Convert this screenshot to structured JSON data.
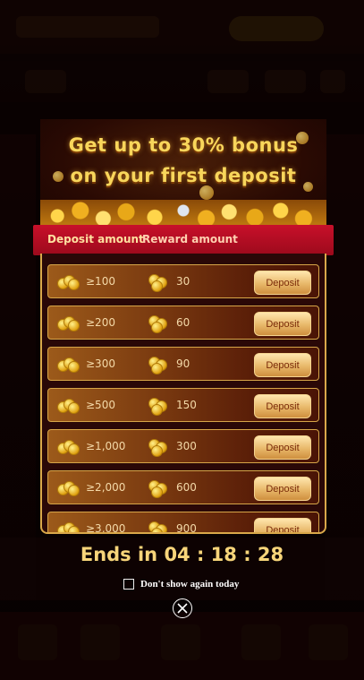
{
  "promo": {
    "headline_line1": "Get up to 30% bonus",
    "headline_line2": "on your first deposit"
  },
  "tabs": {
    "deposit_amount": "Deposit amount",
    "reward_amount": "Reward amount"
  },
  "rows": [
    {
      "amount": "≥100",
      "reward": "30",
      "button": "Deposit"
    },
    {
      "amount": "≥200",
      "reward": "60",
      "button": "Deposit"
    },
    {
      "amount": "≥300",
      "reward": "90",
      "button": "Deposit"
    },
    {
      "amount": "≥500",
      "reward": "150",
      "button": "Deposit"
    },
    {
      "amount": "≥1,000",
      "reward": "300",
      "button": "Deposit"
    },
    {
      "amount": "≥2,000",
      "reward": "600",
      "button": "Deposit"
    },
    {
      "amount": "≥3,000",
      "reward": "900",
      "button": "Deposit"
    }
  ],
  "countdown": {
    "label": "Ends in 04 : 18 : 28"
  },
  "dont_show": {
    "label": "Don't show again today",
    "checked": false
  },
  "colors": {
    "accent_gold": "#f7d57a",
    "tab_red": "#c8102a",
    "row_border": "#d6a548"
  },
  "icons": {
    "amount_icon": "gold-coins-icon",
    "reward_icon": "coin-stack-icon",
    "close_icon": "close-circle-icon"
  }
}
